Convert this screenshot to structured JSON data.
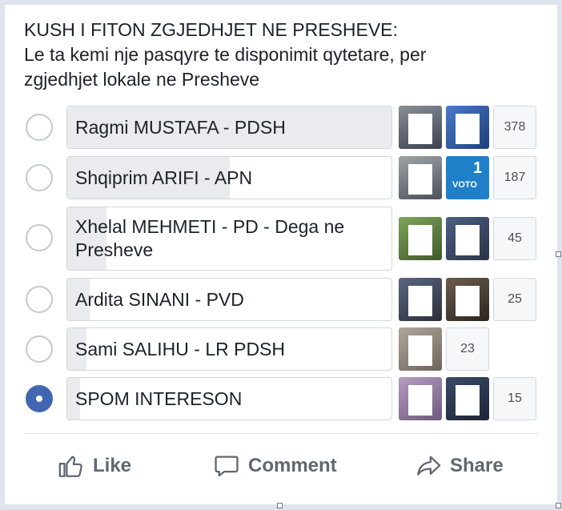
{
  "post": {
    "title_lines": [
      "KUSH I FITON ZGJEDHJET NE PRESHEVE:",
      "Le ta kemi nje pasqyre te disponimit qytetare, per",
      "zgjedhjet lokale ne Presheve"
    ]
  },
  "poll": {
    "options": [
      {
        "label": "Ragmi MUSTAFA - PDSH",
        "votes": "378",
        "selected": false
      },
      {
        "label": "Shqiprim ARIFI - APN",
        "votes": "187",
        "selected": false
      },
      {
        "label_lines": [
          "Xhelal MEHMETI - PD - Dega ne",
          "Presheve"
        ],
        "votes": "45",
        "selected": false
      },
      {
        "label": "Ardita SINANI - PVD",
        "votes": "25",
        "selected": false
      },
      {
        "label": "Sami SALIHU - LR PDSH",
        "votes": "23",
        "selected": false
      },
      {
        "label": "SPOM INTERESON",
        "votes": "15",
        "selected": true
      }
    ],
    "voter_badge": {
      "line1": "1",
      "line2": "VOTO"
    }
  },
  "actions": {
    "like": "Like",
    "comment": "Comment",
    "share": "Share"
  },
  "colors": {
    "accent": "#4267b2",
    "fill": "#e9ebee",
    "text": "#1d2129",
    "muted": "#606770"
  },
  "icons": [
    "thumbs-up-icon",
    "comment-icon",
    "share-icon"
  ]
}
